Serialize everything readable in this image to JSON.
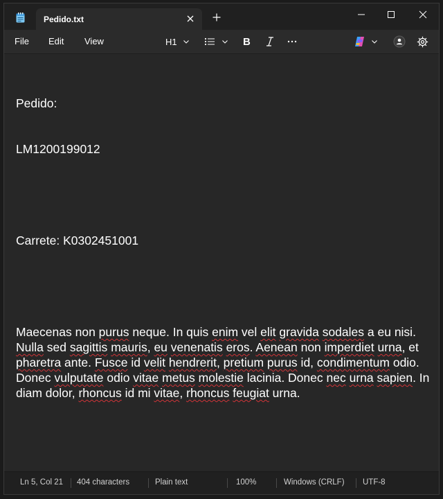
{
  "tab": {
    "title": "Pedido.txt"
  },
  "menu": {
    "file": "File",
    "edit": "Edit",
    "view": "View"
  },
  "toolbar": {
    "heading": "H1"
  },
  "document": {
    "line1": "Pedido:",
    "line2": "LM1200199012",
    "line3": "",
    "line4": "Carrete: K0302451001",
    "line5": "",
    "paragraph": [
      {
        "t": "Maecenas non ",
        "s": false
      },
      {
        "t": "purus",
        "s": true
      },
      {
        "t": " neque. In quis ",
        "s": false
      },
      {
        "t": "enim",
        "s": true
      },
      {
        "t": " vel ",
        "s": false
      },
      {
        "t": "elit",
        "s": true
      },
      {
        "t": " ",
        "s": false
      },
      {
        "t": "gravida",
        "s": true
      },
      {
        "t": " ",
        "s": false
      },
      {
        "t": "sodales",
        "s": true
      },
      {
        "t": " a eu nisi. ",
        "s": false
      },
      {
        "t": "Nulla",
        "s": true
      },
      {
        "t": " sed ",
        "s": false
      },
      {
        "t": "sagittis",
        "s": true
      },
      {
        "t": " ",
        "s": false
      },
      {
        "t": "mauris",
        "s": true
      },
      {
        "t": ", ",
        "s": false
      },
      {
        "t": "eu",
        "s": true
      },
      {
        "t": " ",
        "s": false
      },
      {
        "t": "venenatis",
        "s": true
      },
      {
        "t": " ",
        "s": false
      },
      {
        "t": "eros",
        "s": true
      },
      {
        "t": ". ",
        "s": false
      },
      {
        "t": "Aenean",
        "s": true
      },
      {
        "t": " non ",
        "s": false
      },
      {
        "t": "imperdiet",
        "s": true
      },
      {
        "t": " ",
        "s": false
      },
      {
        "t": "urna",
        "s": true
      },
      {
        "t": ", et ",
        "s": false
      },
      {
        "t": "pharetra",
        "s": true
      },
      {
        "t": " ante. ",
        "s": false
      },
      {
        "t": "Fusce",
        "s": true
      },
      {
        "t": " id ",
        "s": false
      },
      {
        "t": "velit",
        "s": true
      },
      {
        "t": " ",
        "s": false
      },
      {
        "t": "hendrerit",
        "s": true
      },
      {
        "t": ", ",
        "s": false
      },
      {
        "t": "pretium",
        "s": true
      },
      {
        "t": " ",
        "s": false
      },
      {
        "t": "purus",
        "s": true
      },
      {
        "t": " id, ",
        "s": false
      },
      {
        "t": "condimentum",
        "s": true
      },
      {
        "t": " odio. Donec ",
        "s": false
      },
      {
        "t": "vulputate",
        "s": true
      },
      {
        "t": " odio ",
        "s": false
      },
      {
        "t": "vitae",
        "s": true
      },
      {
        "t": " ",
        "s": false
      },
      {
        "t": "metus",
        "s": true
      },
      {
        "t": " ",
        "s": false
      },
      {
        "t": "molestie",
        "s": true
      },
      {
        "t": " lacinia. Donec ",
        "s": false
      },
      {
        "t": "nec",
        "s": true
      },
      {
        "t": " ",
        "s": false
      },
      {
        "t": "urna",
        "s": true
      },
      {
        "t": " ",
        "s": false
      },
      {
        "t": "sapien",
        "s": true
      },
      {
        "t": ". In diam dolor, ",
        "s": false
      },
      {
        "t": "rhoncus",
        "s": true
      },
      {
        "t": " id mi ",
        "s": false
      },
      {
        "t": "vitae",
        "s": true
      },
      {
        "t": ", ",
        "s": false
      },
      {
        "t": "rhoncus",
        "s": true
      },
      {
        "t": " ",
        "s": false
      },
      {
        "t": "feugiat",
        "s": true
      },
      {
        "t": " urna.",
        "s": false
      }
    ]
  },
  "status": {
    "position": "Ln 5, Col 21",
    "characters": "404 characters",
    "format": "Plain text",
    "zoom": "100%",
    "line_ending": "Windows (CRLF)",
    "encoding": "UTF-8"
  },
  "colors": {
    "background": "#272727",
    "titlebar": "#202020",
    "text": "#ffffff",
    "spellcheck": "#d13438",
    "copilot_accent": "#8a5cf6"
  },
  "icons": [
    "notepad-icon",
    "close-icon",
    "plus-icon",
    "minimize-icon",
    "maximize-icon",
    "bullet-list-icon",
    "bold-icon",
    "italic-icon",
    "more-icon",
    "copilot-icon",
    "account-icon",
    "gear-icon",
    "chevron-down-icon"
  ]
}
